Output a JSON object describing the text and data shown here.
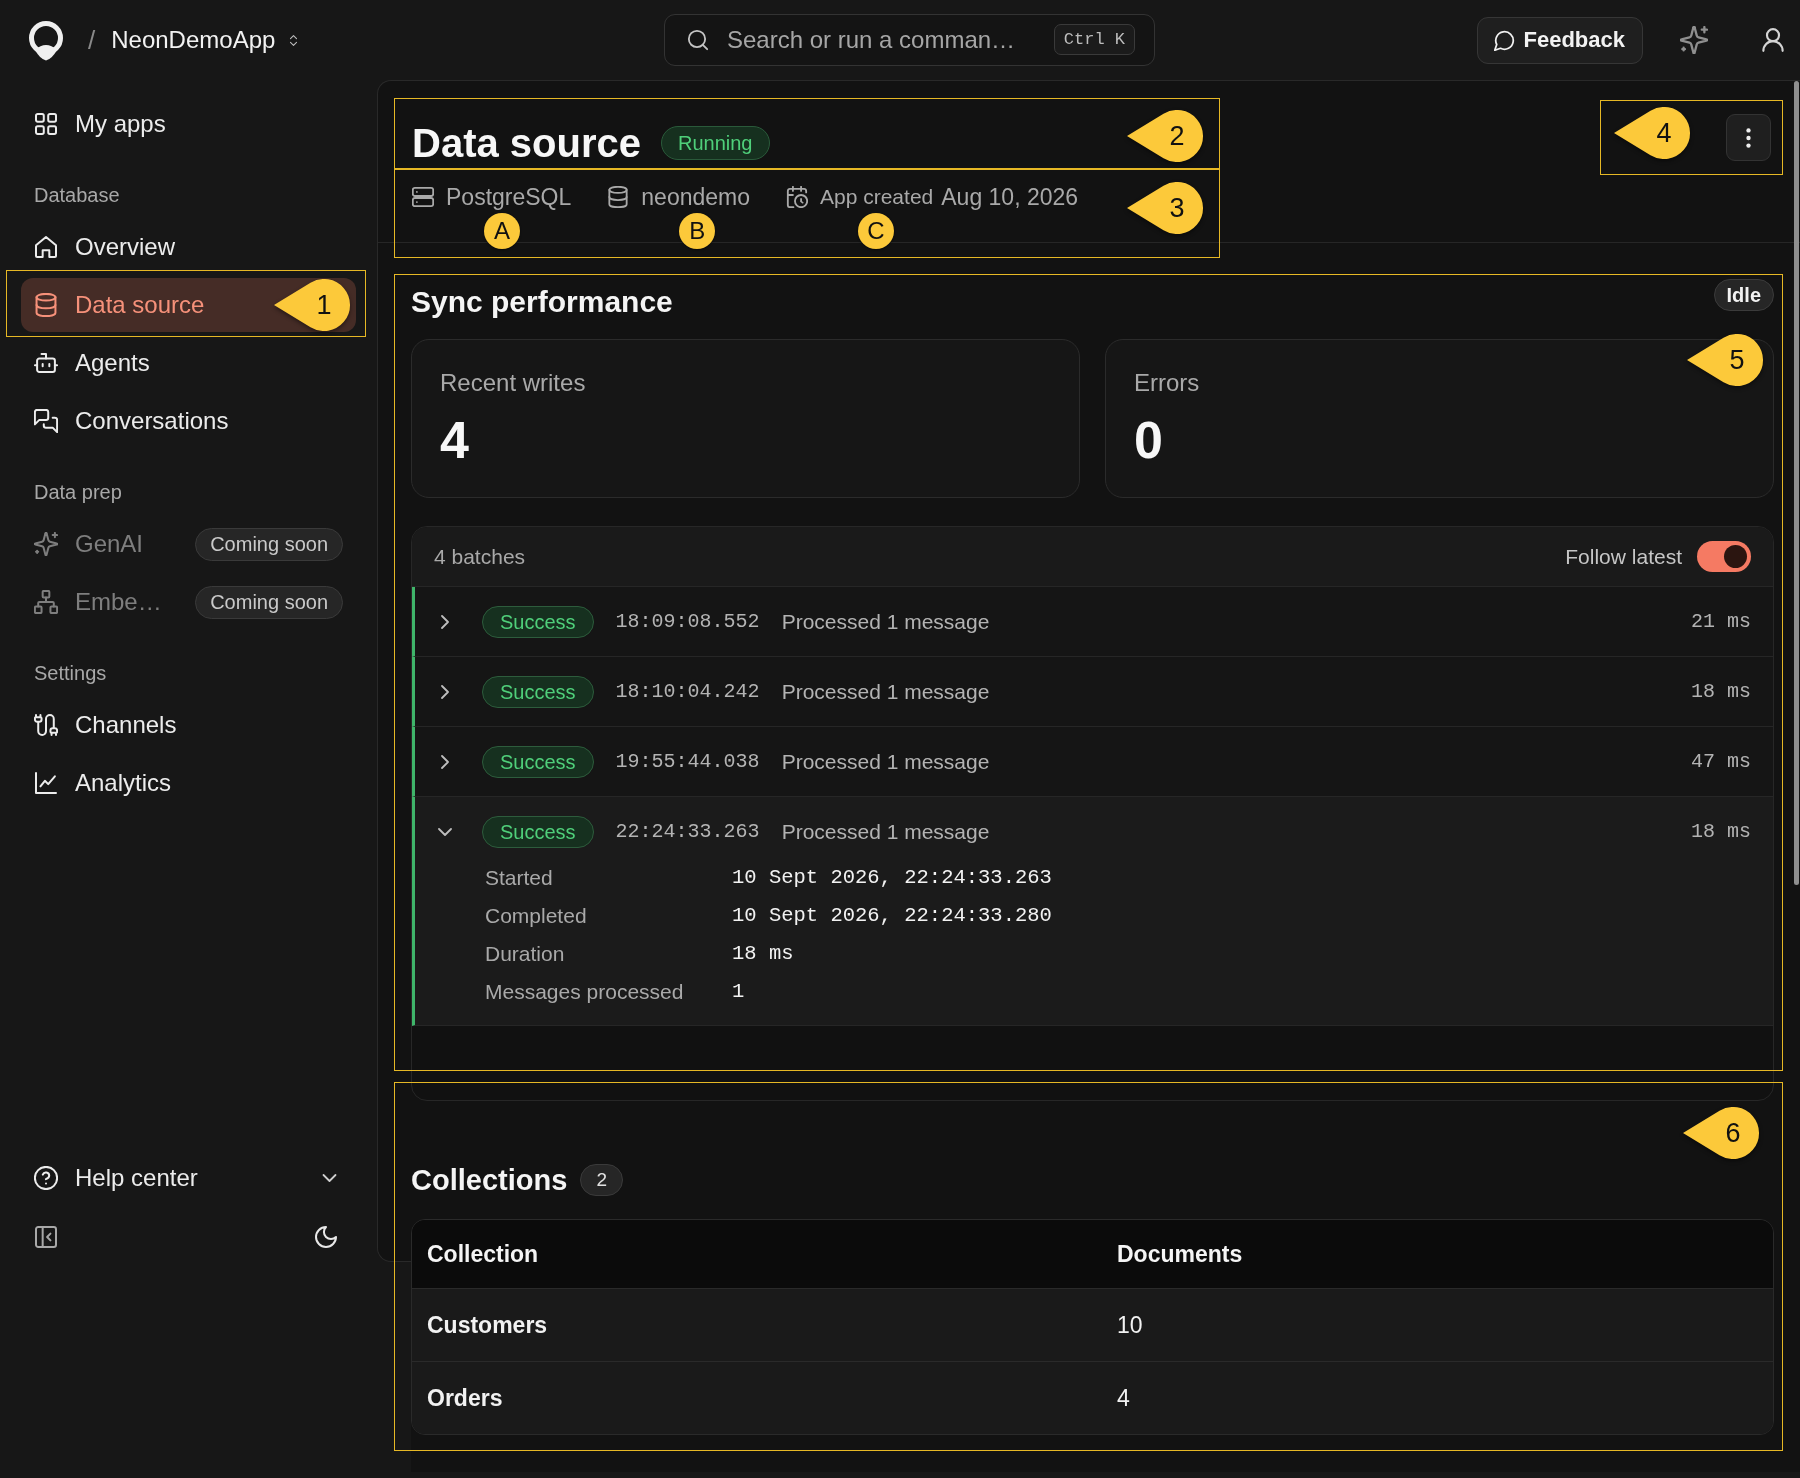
{
  "top_bar": {
    "app": {
      "separator": "/",
      "name": "NeonDemoApp"
    },
    "search": {
      "placeholder": "Search or run a comman…",
      "shortcut": "Ctrl K"
    },
    "feedback_button": {
      "label": "Feedback"
    }
  },
  "sidebar": {
    "top_items": [
      {
        "label": "My apps",
        "selected": false,
        "disabled": false
      }
    ],
    "sections": [
      {
        "title": "Database",
        "items": [
          {
            "label": "Overview",
            "selected": false,
            "disabled": false
          },
          {
            "label": "Data source",
            "selected": true,
            "disabled": false,
            "callout": "1"
          },
          {
            "label": "Agents",
            "selected": false,
            "disabled": false
          },
          {
            "label": "Conversations",
            "selected": false,
            "disabled": false
          }
        ]
      },
      {
        "title": "Data prep",
        "items": [
          {
            "label": "GenAI",
            "selected": false,
            "disabled": true,
            "badge": "Coming soon"
          },
          {
            "label": "Embe…",
            "selected": false,
            "disabled": true,
            "badge": "Coming soon"
          }
        ]
      },
      {
        "title": "Settings",
        "items": [
          {
            "label": "Channels",
            "selected": false,
            "disabled": false
          },
          {
            "label": "Analytics",
            "selected": false,
            "disabled": false
          }
        ]
      }
    ],
    "help": {
      "label": "Help center",
      "expanded": false
    }
  },
  "header": {
    "title": "Data source",
    "status": "Running",
    "callout": "2",
    "meta": {
      "callout": "3",
      "items": [
        {
          "text": "PostgreSQL",
          "marker": "A"
        },
        {
          "text": "neondemo",
          "marker": "B"
        },
        {
          "label": "App created",
          "text": "Aug 10, 2026",
          "marker": "C"
        }
      ]
    },
    "menu": {
      "callout": "4"
    }
  },
  "sync": {
    "title": "Sync performance",
    "state": "Idle",
    "callout": "5",
    "stats": [
      {
        "label": "Recent writes",
        "value": "4"
      },
      {
        "label": "Errors",
        "value": "0"
      }
    ],
    "batches": {
      "count": "4 batches",
      "follow_latest": {
        "label": "Follow latest",
        "on": true
      },
      "rows": [
        {
          "status": "Success",
          "time": "18:09:08.552",
          "message": "Processed 1 message",
          "duration": "21 ms",
          "expanded": false
        },
        {
          "status": "Success",
          "time": "18:10:04.242",
          "message": "Processed 1 message",
          "duration": "18 ms",
          "expanded": false
        },
        {
          "status": "Success",
          "time": "19:55:44.038",
          "message": "Processed 1 message",
          "duration": "47 ms",
          "expanded": false
        },
        {
          "status": "Success",
          "time": "22:24:33.263",
          "message": "Processed 1 message",
          "duration": "18 ms",
          "expanded": true,
          "details": [
            {
              "label": "Started",
              "value": "10 Sept 2026, 22:24:33.263"
            },
            {
              "label": "Completed",
              "value": "10 Sept 2026, 22:24:33.280"
            },
            {
              "label": "Duration",
              "value": "18 ms"
            },
            {
              "label": "Messages processed",
              "value": "1"
            }
          ]
        }
      ]
    }
  },
  "collections": {
    "title": "Collections",
    "count": "2",
    "callout": "6",
    "table": {
      "columns": [
        "Collection",
        "Documents"
      ],
      "rows": [
        [
          "Customers",
          "10"
        ],
        [
          "Orders",
          "4"
        ]
      ]
    }
  }
}
